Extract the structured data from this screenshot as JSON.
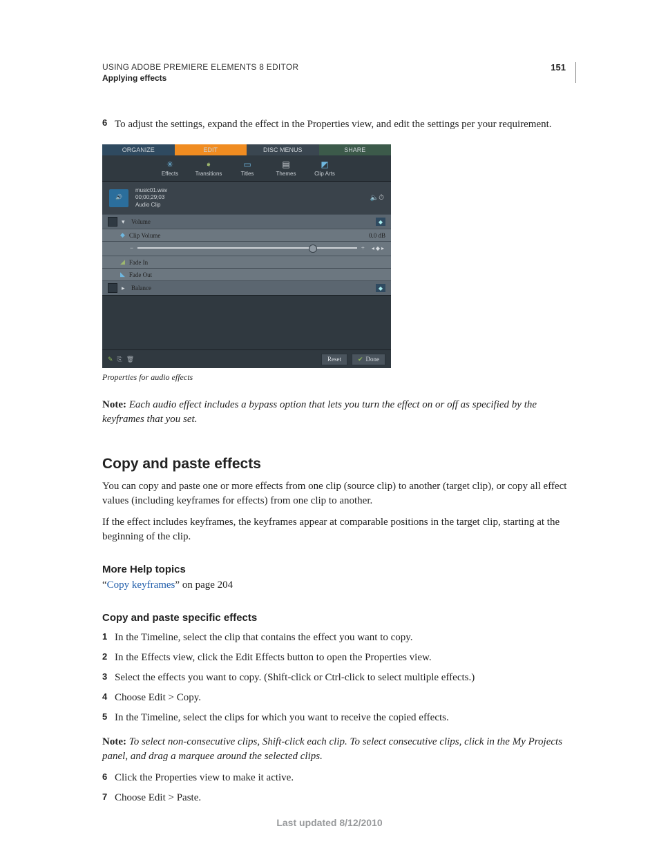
{
  "header": {
    "title": "USING ADOBE PREMIERE ELEMENTS 8 EDITOR",
    "section": "Applying effects",
    "page": "151"
  },
  "intro_step": {
    "num": "6",
    "text": "To adjust the settings, expand the effect in the Properties view, and edit the settings per your requirement."
  },
  "figure": {
    "tabs": {
      "organize": "ORGANIZE",
      "edit": "EDIT",
      "disc": "DISC MENUS",
      "share": "SHARE"
    },
    "tools": {
      "effects": "Effects",
      "transitions": "Transitions",
      "titles": "Titles",
      "themes": "Themes",
      "cliparts": "Clip Arts"
    },
    "clip": {
      "name": "music01.wav",
      "duration": "00;00;29;03",
      "type": "Audio Clip"
    },
    "rows": {
      "volume": "Volume",
      "clipvol_label": "Clip Volume",
      "clipvol_value": "0.0 dB",
      "fadein": "Fade In",
      "fadeout": "Fade Out",
      "balance": "Balance"
    },
    "footer": {
      "reset": "Reset",
      "done": "Done"
    },
    "caption": "Properties for audio effects"
  },
  "note1": {
    "label": "Note:",
    "text": " Each audio effect includes a bypass option that lets you turn the effect on or off as specified by the keyframes that you set."
  },
  "sect_title": "Copy and paste effects",
  "para1": "You can copy and paste one or more effects from one clip (source clip) to another (target clip), or copy all effect values (including keyframes for effects) from one clip to another.",
  "para2": "If the effect includes keyframes, the keyframes appear at comparable positions in the target clip, starting at the beginning of the clip.",
  "more_help": "More Help topics",
  "help_link_pre": "“",
  "help_link": "Copy keyframes",
  "help_link_post": "” on page 204",
  "sub_title": "Copy and paste specific effects",
  "steps": {
    "s1n": "1",
    "s1": "In the Timeline, select the clip that contains the effect you want to copy.",
    "s2n": "2",
    "s2": "In the Effects view, click the Edit Effects button to open the Properties view.",
    "s3n": "3",
    "s3": "Select the effects you want to copy. (Shift-click or Ctrl-click to select multiple effects.)",
    "s4n": "4",
    "s4": "Choose Edit > Copy.",
    "s5n": "5",
    "s5": "In the Timeline, select the clips for which you want to receive the copied effects."
  },
  "note2": {
    "label": "Note:",
    "text": " To select non-consecutive clips, Shift-click each clip. To select consecutive clips, click in the My Projects panel, and drag a marquee around the selected clips."
  },
  "steps_cont": {
    "s6n": "6",
    "s6": "Click the Properties view to make it active.",
    "s7n": "7",
    "s7": "Choose Edit > Paste."
  },
  "footer_date": "Last updated 8/12/2010"
}
